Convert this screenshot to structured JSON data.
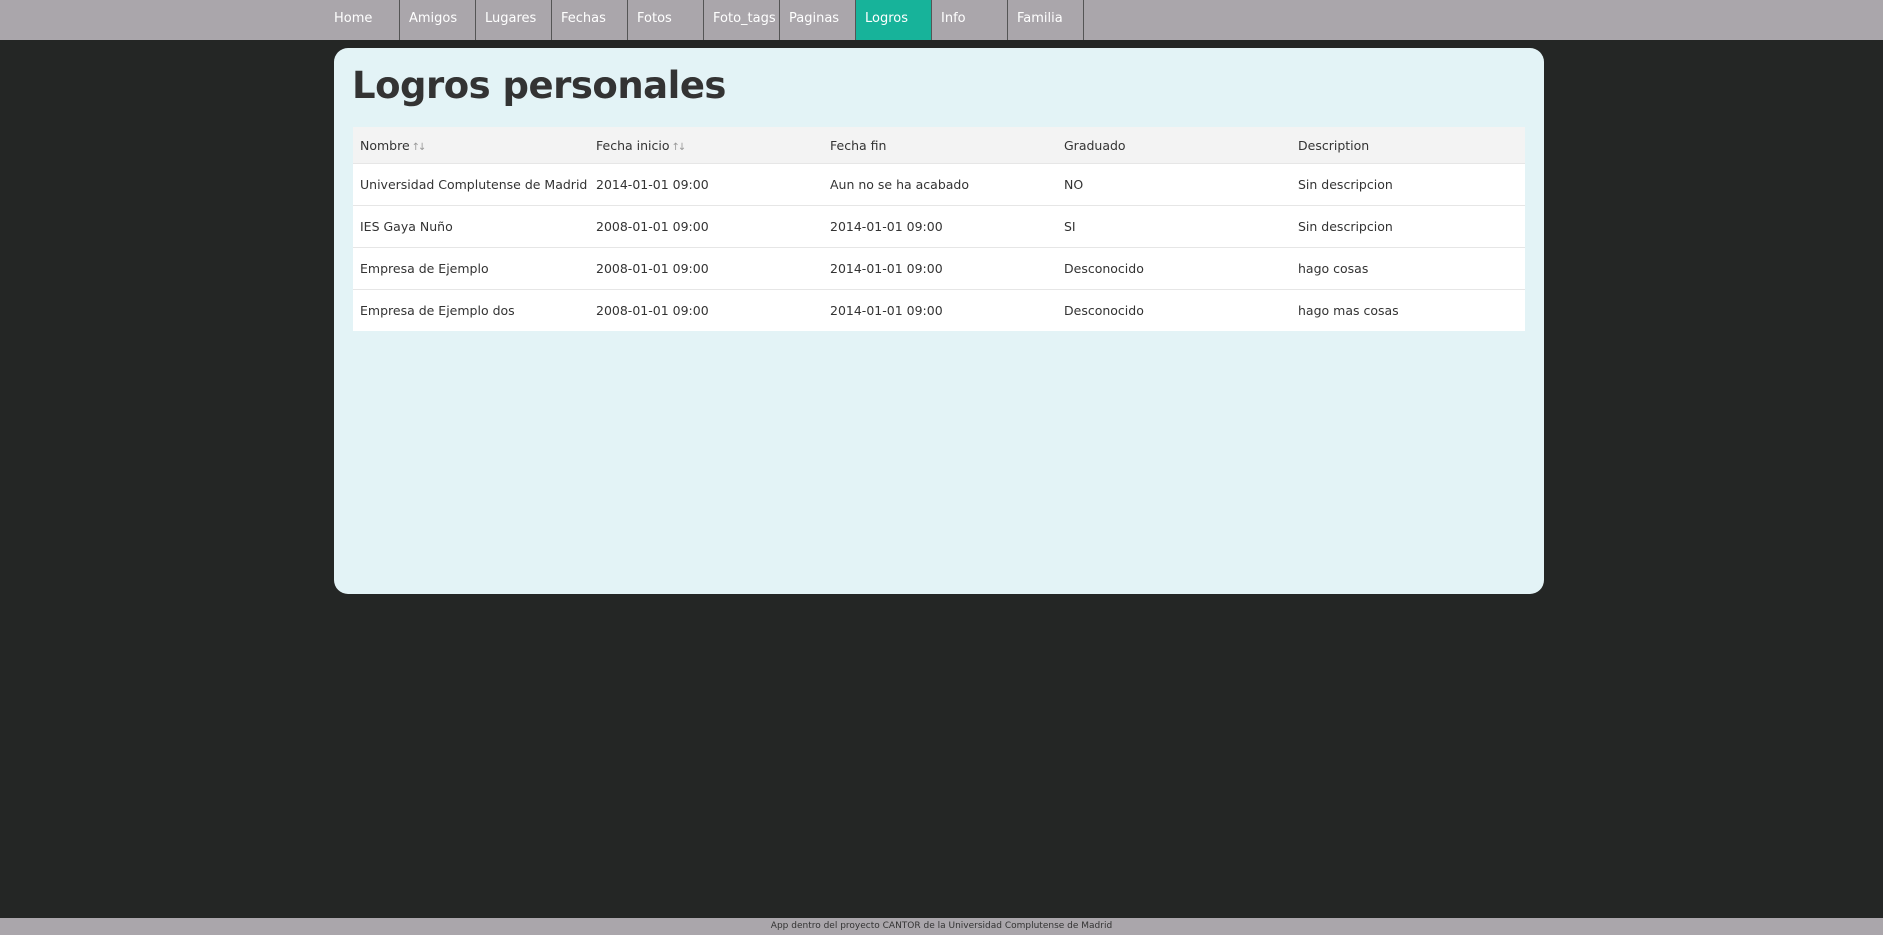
{
  "nav": {
    "items": [
      {
        "label": "Home"
      },
      {
        "label": "Amigos"
      },
      {
        "label": "Lugares"
      },
      {
        "label": "Fechas"
      },
      {
        "label": "Fotos"
      },
      {
        "label": "Foto_tags"
      },
      {
        "label": "Paginas"
      },
      {
        "label": "Logros"
      },
      {
        "label": "Info"
      },
      {
        "label": "Familia"
      }
    ],
    "active": "Logros",
    "active_color": "#17b39a",
    "bar_color": "#aaa6ab"
  },
  "page": {
    "title": "Logros personales",
    "panel_color": "#e3f3f6",
    "background_color": "#242625"
  },
  "table": {
    "headers": [
      "Nombre",
      "Fecha inicio",
      "Fecha fin",
      "Graduado",
      "Description"
    ],
    "sortable_icon": "sort-arrows-icon",
    "rows": [
      [
        "Universidad Complutense de Madrid",
        "2014-01-01 09:00",
        "Aun no se ha acabado",
        "NO",
        "Sin descripcion"
      ],
      [
        "IES Gaya Nuño",
        "2008-01-01 09:00",
        "2014-01-01 09:00",
        "SI",
        "Sin descripcion"
      ],
      [
        "Empresa de Ejemplo",
        "2008-01-01 09:00",
        "2014-01-01 09:00",
        "Desconocido",
        "hago cosas"
      ],
      [
        "Empresa de Ejemplo dos",
        "2008-01-01 09:00",
        "2014-01-01 09:00",
        "Desconocido",
        "hago mas cosas"
      ]
    ]
  },
  "footer": {
    "text": "App dentro del proyecto CANTOR de la Universidad Complutense de Madrid"
  }
}
